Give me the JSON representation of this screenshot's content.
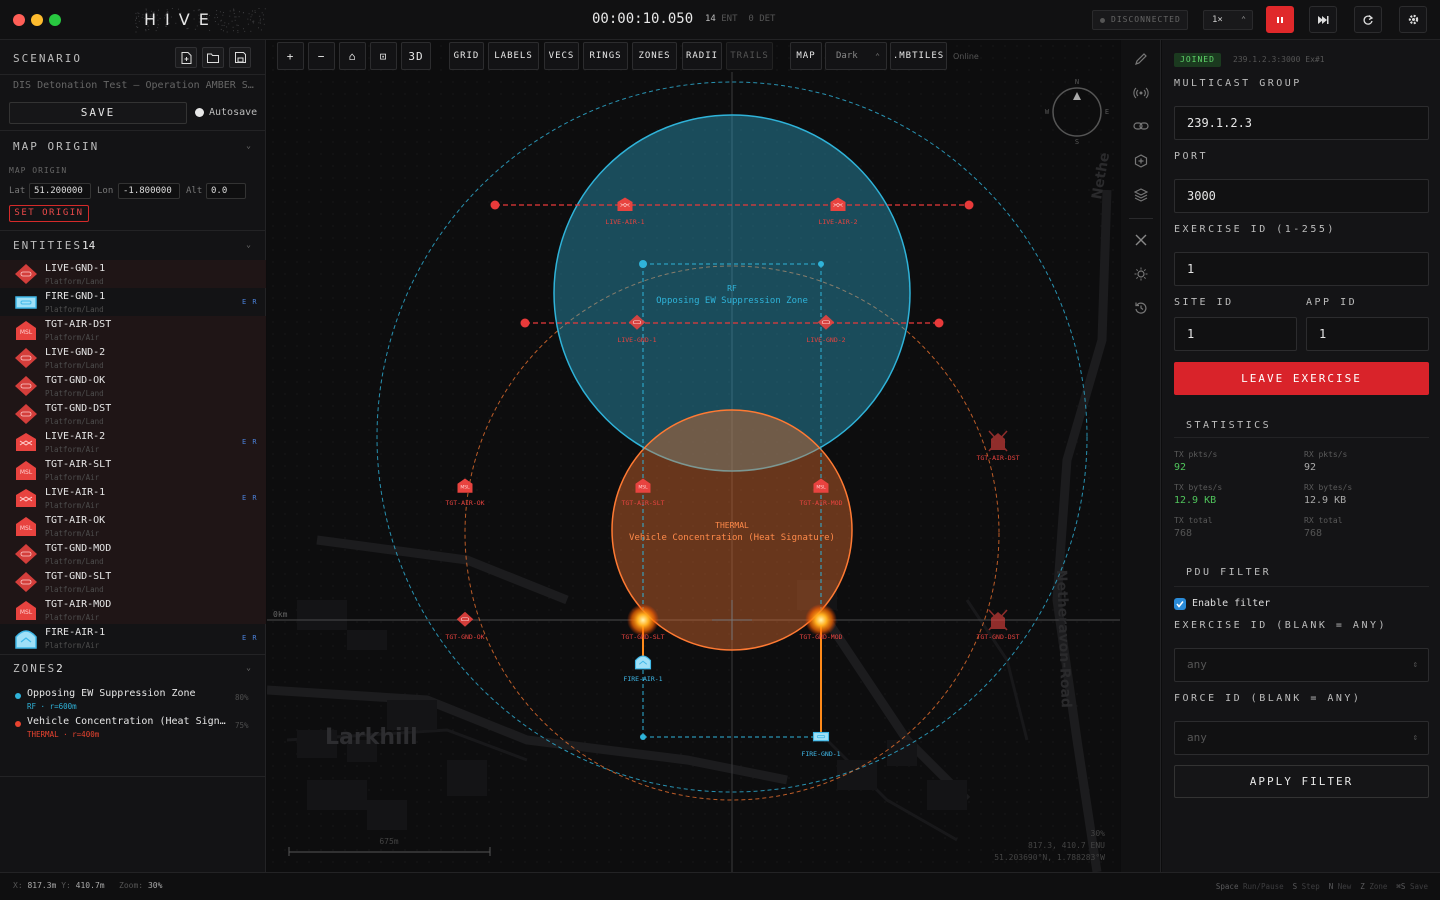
{
  "topbar": {
    "title": "HIVE",
    "clock": "00:00:10.050",
    "ent_count": "14",
    "ent_label": "ENT",
    "det_count": "0",
    "det_label": "DET",
    "status": "DISCONNECTED",
    "speed": "1×",
    "colors": {
      "red": "#ff5f57",
      "yellow": "#febc2e",
      "green": "#28c840",
      "accent": "#e0282a"
    }
  },
  "scenario": {
    "heading": "SCENARIO",
    "name": "DIS Detonation Test — Operation AMBER S…",
    "save_label": "SAVE",
    "autosave_label": "Autosave"
  },
  "map_origin": {
    "heading": "MAP ORIGIN",
    "sublabel": "MAP ORIGIN",
    "lat_label": "Lat",
    "lat": "51.200000",
    "lon_label": "Lon",
    "lon": "-1.800000",
    "alt_label": "Alt",
    "alt": "0.0",
    "set_label": "SET ORIGIN"
  },
  "entities": {
    "heading": "ENTITIES",
    "count": "14",
    "items": [
      {
        "name": "LIVE-GND-1",
        "sub": "Platform/Land",
        "er": "",
        "kind": "gnd-red",
        "hl": true
      },
      {
        "name": "FIRE-GND-1",
        "sub": "Platform/Land",
        "er": "E R",
        "kind": "gnd-blue",
        "hl": false
      },
      {
        "name": "TGT-AIR-DST",
        "sub": "Platform/Air",
        "er": "",
        "kind": "air-red",
        "hl": true
      },
      {
        "name": "LIVE-GND-2",
        "sub": "Platform/Land",
        "er": "",
        "kind": "gnd-red",
        "hl": true
      },
      {
        "name": "TGT-GND-OK",
        "sub": "Platform/Land",
        "er": "",
        "kind": "gnd-red",
        "hl": true
      },
      {
        "name": "TGT-GND-DST",
        "sub": "Platform/Land",
        "er": "",
        "kind": "gnd-red",
        "hl": true
      },
      {
        "name": "LIVE-AIR-2",
        "sub": "Platform/Air",
        "er": "E R",
        "kind": "air2-red",
        "hl": true
      },
      {
        "name": "TGT-AIR-SLT",
        "sub": "Platform/Air",
        "er": "",
        "kind": "air-red",
        "hl": true
      },
      {
        "name": "LIVE-AIR-1",
        "sub": "Platform/Air",
        "er": "E R",
        "kind": "air2-red",
        "hl": true
      },
      {
        "name": "TGT-AIR-OK",
        "sub": "Platform/Air",
        "er": "",
        "kind": "air-red",
        "hl": true
      },
      {
        "name": "TGT-GND-MOD",
        "sub": "Platform/Land",
        "er": "",
        "kind": "gnd-red",
        "hl": true
      },
      {
        "name": "TGT-GND-SLT",
        "sub": "Platform/Land",
        "er": "",
        "kind": "gnd-red",
        "hl": true
      },
      {
        "name": "TGT-AIR-MOD",
        "sub": "Platform/Air",
        "er": "",
        "kind": "air-red",
        "hl": true
      },
      {
        "name": "FIRE-AIR-1",
        "sub": "Platform/Air",
        "er": "E R",
        "kind": "air-blue",
        "hl": false
      }
    ]
  },
  "zones": {
    "heading": "ZONES",
    "count": "2",
    "items": [
      {
        "name": "Opposing EW Suppression Zone",
        "sub": "RF · r=600m",
        "pct": "80%",
        "color": "#2fb3d9"
      },
      {
        "name": "Vehicle Concentration (Heat Sign…",
        "sub": "THERMAL · r=400m",
        "pct": "75%",
        "color": "#e8432f"
      }
    ]
  },
  "map_toolbar": {
    "plus": "+",
    "minus": "−",
    "home": "⌂",
    "fit": "⊡",
    "btn3d": "3D",
    "grid": "GRID",
    "labels": "LABELS",
    "vecs": "VECS",
    "rings": "RINGS",
    "zones": "ZONES",
    "radii": "RADII",
    "trails": "TRAILS",
    "map": "MAP",
    "style": "Dark",
    "mbtiles": ".MBTILES",
    "online": "Online"
  },
  "map": {
    "zone_rf_type": "RF",
    "zone_rf_name": "Opposing EW Suppression Zone",
    "zone_th_type": "THERMAL",
    "zone_th_name": "Vehicle Concentration (Heat Signature)",
    "place_name": "Larkhill",
    "road_name_1": "Netheravon-Road",
    "road_name_2": "Nethe",
    "km_label": "0km",
    "scale_label": "675m",
    "readout_zoom": "30%",
    "readout_enu": "817.3, 410.7 ENU",
    "readout_geo": "51.203690°N, 1.788283°W",
    "compass_n": "N",
    "compass_e": "E",
    "compass_s": "S",
    "compass_w": "W",
    "labels": {
      "live_air_1": "LIVE-AIR-1",
      "live_air_2": "LIVE-AIR-2",
      "live_gnd_1": "LIVE-GND-1",
      "live_gnd_2": "LIVE-GND-2",
      "tgt_air_ok": "TGT-AIR-OK",
      "tgt_air_slt": "TGT-AIR-SLT",
      "tgt_air_mod": "TGT-AIR-MOD",
      "tgt_air_dst": "TGT-AIR-DST",
      "tgt_gnd_ok": "TGT-GND-OK",
      "tgt_gnd_slt": "TGT-GND-SLT",
      "tgt_gnd_mod": "TGT-GND-MOD",
      "tgt_gnd_dst": "TGT-GND-DST",
      "fire_air_1": "FIRE-AIR-1",
      "fire_gnd_1": "FIRE-GND-1"
    }
  },
  "right": {
    "joined": "JOINED",
    "joined_info": "239.1.2.3:3000 Ex#1",
    "multicast_label": "MULTICAST GROUP",
    "multicast": "239.1.2.3",
    "port_label": "PORT",
    "port": "3000",
    "exercise_label": "EXERCISE ID (1-255)",
    "exercise": "1",
    "site_label": "SITE ID",
    "site": "1",
    "app_label": "APP ID",
    "app": "1",
    "leave_label": "LEAVE EXERCISE",
    "stats_heading": "STATISTICS",
    "stats": {
      "tx_pkts_label": "TX pkts/s",
      "tx_pkts": "92",
      "rx_pkts_label": "RX pkts/s",
      "rx_pkts": "92",
      "tx_bytes_label": "TX bytes/s",
      "tx_bytes": "12.9 KB",
      "rx_bytes_label": "RX bytes/s",
      "rx_bytes": "12.9 KB",
      "tx_total_label": "TX total",
      "tx_total": "768",
      "rx_total_label": "RX total",
      "rx_total": "768"
    },
    "pdu_heading": "PDU FILTER",
    "enable_filter": "Enable filter",
    "filter_ex_label": "EXERCISE ID (BLANK = ANY)",
    "filter_ex_ph": "any",
    "force_label": "FORCE ID (BLANK = ANY)",
    "force_ph": "any",
    "apply_label": "APPLY FILTER"
  },
  "bottom": {
    "x_label": "X:",
    "x": "817.3m",
    "y_label": "Y:",
    "y": "410.7m",
    "zoom_label": "Zoom:",
    "zoom": "30%",
    "hints": [
      {
        "key": "Space",
        "text": "Run/Pause"
      },
      {
        "key": "S",
        "text": "Step"
      },
      {
        "key": "N",
        "text": "New"
      },
      {
        "key": "Z",
        "text": "Zone"
      },
      {
        "key": "⌘S",
        "text": "Save"
      }
    ]
  }
}
